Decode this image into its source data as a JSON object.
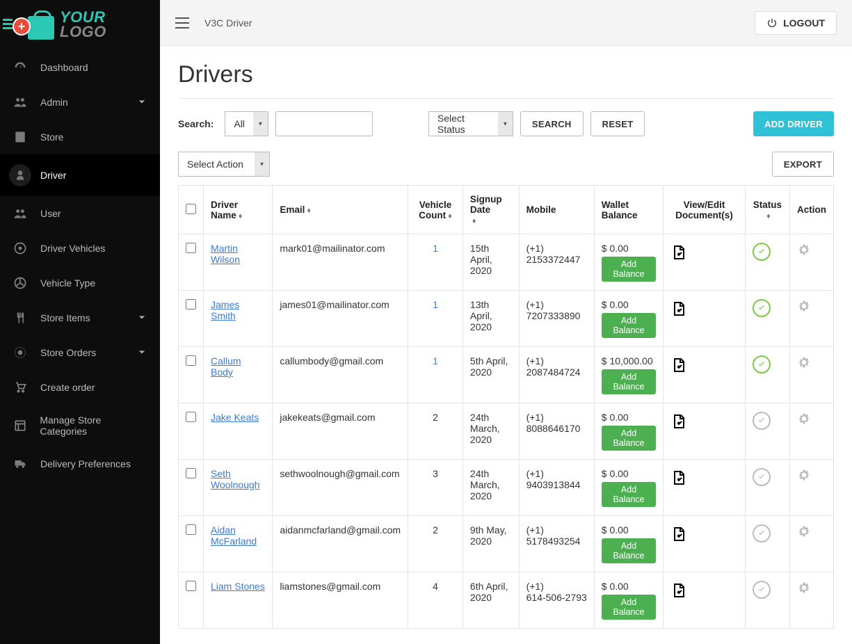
{
  "logo": {
    "line1": "YOUR",
    "line2": "LOGO"
  },
  "breadcrumb": "V3C  Driver",
  "logout_label": "LOGOUT",
  "page_title": "Drivers",
  "search_label": "Search:",
  "filter_all": "All",
  "filter_status": "Select Status",
  "search_btn": "SEARCH",
  "reset_btn": "RESET",
  "add_driver_btn": "ADD DRIVER",
  "select_action": "Select Action",
  "export_btn": "EXPORT",
  "add_balance_label": "Add Balance",
  "sidebar": {
    "items": [
      {
        "label": "Dashboard",
        "icon": "dashboard-icon",
        "expandable": false
      },
      {
        "label": "Admin",
        "icon": "admin-icon",
        "expandable": true
      },
      {
        "label": "Store",
        "icon": "store-icon",
        "expandable": false
      },
      {
        "label": "Driver",
        "icon": "driver-icon",
        "expandable": false,
        "active": true
      },
      {
        "label": "User",
        "icon": "user-icon",
        "expandable": false
      },
      {
        "label": "Driver Vehicles",
        "icon": "vehicles-icon",
        "expandable": false
      },
      {
        "label": "Vehicle Type",
        "icon": "vehicle-type-icon",
        "expandable": false
      },
      {
        "label": "Store Items",
        "icon": "store-items-icon",
        "expandable": true
      },
      {
        "label": "Store Orders",
        "icon": "store-orders-icon",
        "expandable": true
      },
      {
        "label": "Create order",
        "icon": "create-order-icon",
        "expandable": false
      },
      {
        "label": "Manage Store Categories",
        "icon": "categories-icon",
        "expandable": false
      },
      {
        "label": "Delivery Preferences",
        "icon": "delivery-icon",
        "expandable": false
      }
    ]
  },
  "columns": {
    "driver_name": "Driver Name",
    "email": "Email",
    "vehicle_count": "Vehicle Count",
    "signup_date": "Signup Date",
    "mobile": "Mobile",
    "wallet_balance": "Wallet Balance",
    "documents": "View/Edit Document(s)",
    "status": "Status",
    "action": "Action"
  },
  "rows": [
    {
      "name": "Martin Wilson",
      "email": "mark01@mailinator.com",
      "vehicle_count": "1",
      "signup": "15th April, 2020",
      "mobile_cc": "(+1)",
      "mobile": "2153372447",
      "balance": "$ 0.00",
      "status": "active"
    },
    {
      "name": "James Smith",
      "email": "james01@mailinator.com",
      "vehicle_count": "1",
      "signup": "13th April, 2020",
      "mobile_cc": "(+1)",
      "mobile": "7207333890",
      "balance": "$ 0.00",
      "status": "active"
    },
    {
      "name": "Callum Body",
      "email": "callumbody@gmail.com",
      "vehicle_count": "1",
      "signup": "5th April, 2020",
      "mobile_cc": "(+1)",
      "mobile": "2087484724",
      "balance": "$ 10,000.00",
      "status": "active"
    },
    {
      "name": "Jake Keats",
      "email": "jakekeats@gmail.com",
      "vehicle_count": "2",
      "signup": "24th March, 2020",
      "mobile_cc": "(+1)",
      "mobile": "8088646170",
      "balance": "$ 0.00",
      "status": "inactive"
    },
    {
      "name": "Seth Woolnough",
      "email": "sethwoolnough@gmail.com",
      "vehicle_count": "3",
      "signup": "24th March, 2020",
      "mobile_cc": "(+1)",
      "mobile": "9403913844",
      "balance": "$ 0.00",
      "status": "inactive"
    },
    {
      "name": "Aidan McFarland",
      "email": "aidanmcfarland@gmail.com",
      "vehicle_count": "2",
      "signup": "9th May, 2020",
      "mobile_cc": "(+1)",
      "mobile": "5178493254",
      "balance": "$ 0.00",
      "status": "inactive"
    },
    {
      "name": "Liam Stones",
      "email": "liamstones@gmail.com",
      "vehicle_count": "4",
      "signup": "6th April, 2020",
      "mobile_cc": "(+1)",
      "mobile": "614-506-2793",
      "balance": "$ 0.00",
      "status": "inactive"
    }
  ]
}
